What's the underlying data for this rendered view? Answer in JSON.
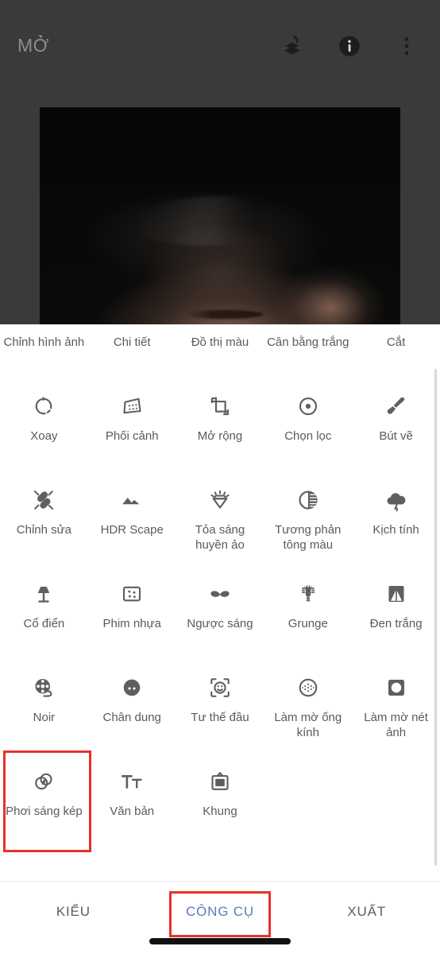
{
  "app": {
    "header": {
      "title": "MỞ",
      "actions": [
        {
          "name": "revert-layers-icon",
          "label": "revert-layers-icon"
        },
        {
          "name": "info-icon",
          "label": "info-icon"
        },
        {
          "name": "overflow-menu-icon",
          "label": "more-options"
        }
      ]
    },
    "canvas": {
      "alt": "edited-photo-preview"
    }
  },
  "tools": {
    "items": [
      {
        "label": "Chỉnh\nhình ảnh",
        "icon": "tune-image-icon",
        "name": "tool-chinh-hinh-anh"
      },
      {
        "label": "Chi tiết",
        "icon": "details-icon",
        "name": "tool-chi-tiet"
      },
      {
        "label": "Đồ thị màu",
        "icon": "curves-icon",
        "name": "tool-do-thi-mau"
      },
      {
        "label": "Cân bằng\ntrắng",
        "icon": "white-balance-icon",
        "name": "tool-can-bang-trang"
      },
      {
        "label": "Cắt",
        "icon": "crop-icon",
        "name": "tool-cat"
      },
      {
        "label": "Xoay",
        "icon": "rotate-icon",
        "name": "tool-xoay"
      },
      {
        "label": "Phối cảnh",
        "icon": "perspective-icon",
        "name": "tool-phoi-canh"
      },
      {
        "label": "Mở rộng",
        "icon": "expand-icon",
        "name": "tool-mo-rong"
      },
      {
        "label": "Chọn lọc",
        "icon": "selective-icon",
        "name": "tool-chon-loc"
      },
      {
        "label": "Bút vẽ",
        "icon": "brush-icon",
        "name": "tool-but-ve"
      },
      {
        "label": "Chỉnh sửa",
        "icon": "healing-icon",
        "name": "tool-chinh-sua"
      },
      {
        "label": "HDR Scape",
        "icon": "hdr-mountains-icon",
        "name": "tool-hdr-scape"
      },
      {
        "label": "Tỏa sáng\nhuyền ảo",
        "icon": "glamour-glow-icon",
        "name": "tool-toa-sang-huyen-ao"
      },
      {
        "label": "Tương phản\ntông màu",
        "icon": "tonal-contrast-icon",
        "name": "tool-tuong-phan-tong-mau"
      },
      {
        "label": "Kịch tính",
        "icon": "drama-cloud-icon",
        "name": "tool-kich-tinh"
      },
      {
        "label": "Cổ điển",
        "icon": "vintage-lamp-icon",
        "name": "tool-co-dien"
      },
      {
        "label": "Phim nhựa",
        "icon": "grainy-film-icon",
        "name": "tool-phim-nhua"
      },
      {
        "label": "Ngược sáng",
        "icon": "retrolux-mustache-icon",
        "name": "tool-nguoc-sang"
      },
      {
        "label": "Grunge",
        "icon": "grunge-guitar-icon",
        "name": "tool-grunge"
      },
      {
        "label": "Đen trắng",
        "icon": "black-white-icon",
        "name": "tool-den-trang"
      },
      {
        "label": "Noir",
        "icon": "film-reel-icon",
        "name": "tool-noir"
      },
      {
        "label": "Chân dung",
        "icon": "portrait-face-icon",
        "name": "tool-chan-dung"
      },
      {
        "label": "Tư thế đầu",
        "icon": "head-pose-icon",
        "name": "tool-tu-the-dau"
      },
      {
        "label": "Làm mờ\nống kính",
        "icon": "lens-blur-icon",
        "name": "tool-lam-mo-ong-kinh"
      },
      {
        "label": "Làm mờ\nnét ảnh",
        "icon": "image-blur-icon",
        "name": "tool-lam-mo-net-anh"
      },
      {
        "label": "Phơi sáng\nkép",
        "icon": "double-exposure-icon",
        "name": "tool-phoi-sang-kep",
        "highlighted": true
      },
      {
        "label": "Văn bản",
        "icon": "text-icon",
        "name": "tool-van-ban"
      },
      {
        "label": "Khung",
        "icon": "frame-icon",
        "name": "tool-khung"
      }
    ]
  },
  "tabbar": {
    "tabs": [
      {
        "label": "KIỂU",
        "name": "tab-kieu",
        "active": false,
        "boxed": false
      },
      {
        "label": "CÔNG CỤ",
        "name": "tab-cong-cu",
        "active": true,
        "boxed": true
      },
      {
        "label": "XUẤT",
        "name": "tab-xuat",
        "active": false,
        "boxed": false
      }
    ]
  },
  "colors": {
    "accent_blue": "#5b7cba",
    "annotation_red": "#e8312a",
    "sheet_bg": "#ffffff",
    "chrome_bg": "#3a3a3a",
    "label_gray": "#5a5a5a"
  }
}
